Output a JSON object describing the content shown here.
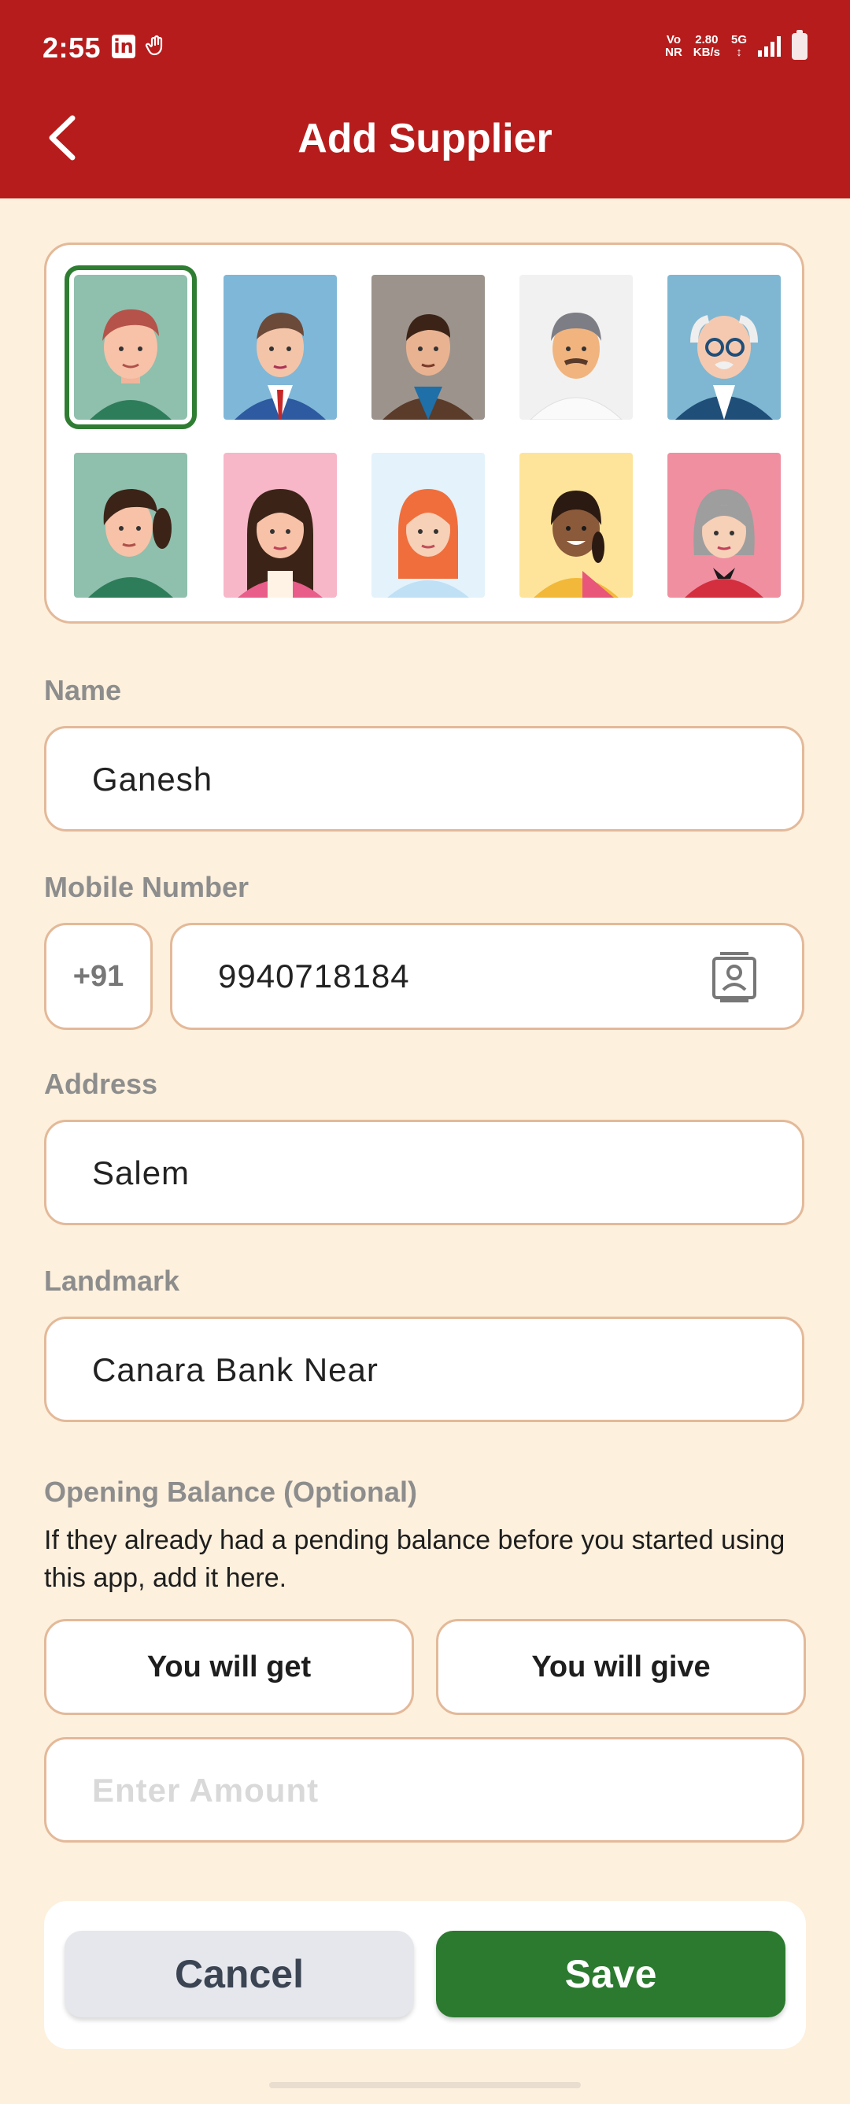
{
  "status_bar": {
    "time": "2:55",
    "linkedin_glyph": "in",
    "net_top": "Vo",
    "net_bottom": "NR",
    "speed_value": "2.80",
    "speed_unit": "KB/s",
    "network": "5G"
  },
  "header": {
    "title": "Add Supplier"
  },
  "avatars": {
    "selected_index": 0,
    "items": [
      {
        "name": "young-man-red-hair",
        "bg": "#8fbfad"
      },
      {
        "name": "man-suit-red-tie",
        "bg": "#7fb7d8"
      },
      {
        "name": "man-brown-jacket",
        "bg": "#9c948c"
      },
      {
        "name": "older-man-mustache",
        "bg": "#f1f1f1"
      },
      {
        "name": "elderly-man-glasses",
        "bg": "#7fb7d2"
      },
      {
        "name": "woman-ponytail",
        "bg": "#8fbfad"
      },
      {
        "name": "woman-long-hair",
        "bg": "#f7b7c8"
      },
      {
        "name": "woman-red-hair",
        "bg": "#e3f2fb"
      },
      {
        "name": "woman-saree",
        "bg": "#fde49a"
      },
      {
        "name": "elderly-woman",
        "bg": "#ef8fa0"
      }
    ]
  },
  "form": {
    "name_label": "Name",
    "name_value": "Ganesh",
    "mobile_label": "Mobile Number",
    "country_code": "+91",
    "mobile_value": "9940718184",
    "address_label": "Address",
    "address_value": "Salem",
    "landmark_label": "Landmark",
    "landmark_value": "Canara Bank Near",
    "opening_label": "Opening Balance (Optional)",
    "opening_help": "If they already had a pending balance before you started using this app, add it here.",
    "get_label": "You will get",
    "give_label": "You will give",
    "amount_placeholder": "Enter Amount"
  },
  "actions": {
    "cancel": "Cancel",
    "save": "Save"
  },
  "colors": {
    "primary": "#b71c1c",
    "accent": "#2b7a2f",
    "background": "#fdf0dd",
    "border": "#e3b999"
  }
}
